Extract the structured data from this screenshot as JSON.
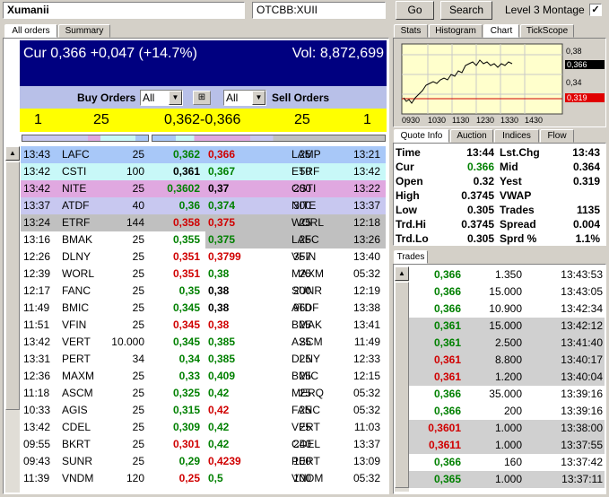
{
  "header": {
    "symbol_name": "Xumanii",
    "symbol_code": "OTCBB:XUII",
    "go": "Go",
    "search": "Search",
    "level3": "Level 3 Montage",
    "check": "✓"
  },
  "left_tabs": [
    "All orders",
    "Summary"
  ],
  "summary": {
    "cur": "Cur 0,366 +0,047 (+14.7%)",
    "vol": "Vol: 8,872,699"
  },
  "orders_bar": {
    "buy": "Buy Orders",
    "sell": "Sell Orders",
    "buy_filter": "All",
    "sell_filter": "All"
  },
  "inside": {
    "bid_count": "1",
    "bid_size": "25",
    "spread": "0,362-0,366",
    "ask_size": "25",
    "ask_count": "1"
  },
  "colors": {
    "navy": "#000080",
    "yellow": "#ffff00",
    "lav": "#c8c8f0",
    "blue": "#a8c8f8",
    "cyan": "#c8f8f8",
    "pink": "#e0a8e0",
    "lgray": "#d0d0d0",
    "mgray": "#c0c0c0"
  },
  "bids": [
    {
      "t": "13:43",
      "mm": "LAFC",
      "sz": "25",
      "px": "0,362",
      "c": "g",
      "bg": "blue"
    },
    {
      "t": "13:42",
      "mm": "CSTI",
      "sz": "100",
      "px": "0,361",
      "c": "k",
      "bg": "cyan"
    },
    {
      "t": "13:42",
      "mm": "NITE",
      "sz": "25",
      "px": "0,3602",
      "c": "g",
      "bg": "pink"
    },
    {
      "t": "13:37",
      "mm": "ATDF",
      "sz": "40",
      "px": "0,36",
      "c": "g",
      "bg": "lav"
    },
    {
      "t": "13:24",
      "mm": "ETRF",
      "sz": "144",
      "px": "0,358",
      "c": "r",
      "bg": "mgray"
    },
    {
      "t": "13:16",
      "mm": "BMAK",
      "sz": "25",
      "px": "0,355",
      "c": "g",
      "bg": ""
    },
    {
      "t": "12:26",
      "mm": "DLNY",
      "sz": "25",
      "px": "0,351",
      "c": "r",
      "bg": ""
    },
    {
      "t": "12:39",
      "mm": "WORL",
      "sz": "25",
      "px": "0,351",
      "c": "r",
      "bg": ""
    },
    {
      "t": "12:17",
      "mm": "FANC",
      "sz": "25",
      "px": "0,35",
      "c": "g",
      "bg": ""
    },
    {
      "t": "11:49",
      "mm": "BMIC",
      "sz": "25",
      "px": "0,345",
      "c": "g",
      "bg": ""
    },
    {
      "t": "11:51",
      "mm": "VFIN",
      "sz": "25",
      "px": "0,345",
      "c": "r",
      "bg": ""
    },
    {
      "t": "13:42",
      "mm": "VERT",
      "sz": "10.000",
      "px": "0,345",
      "c": "g",
      "bg": ""
    },
    {
      "t": "13:31",
      "mm": "PERT",
      "sz": "34",
      "px": "0,34",
      "c": "g",
      "bg": ""
    },
    {
      "t": "12:36",
      "mm": "MAXM",
      "sz": "25",
      "px": "0,33",
      "c": "g",
      "bg": ""
    },
    {
      "t": "11:18",
      "mm": "ASCM",
      "sz": "25",
      "px": "0,325",
      "c": "g",
      "bg": ""
    },
    {
      "t": "10:33",
      "mm": "AGIS",
      "sz": "25",
      "px": "0,315",
      "c": "g",
      "bg": ""
    },
    {
      "t": "13:42",
      "mm": "CDEL",
      "sz": "25",
      "px": "0,309",
      "c": "g",
      "bg": ""
    },
    {
      "t": "09:55",
      "mm": "BKRT",
      "sz": "25",
      "px": "0,301",
      "c": "r",
      "bg": ""
    },
    {
      "t": "09:43",
      "mm": "SUNR",
      "sz": "25",
      "px": "0,29",
      "c": "g",
      "bg": ""
    },
    {
      "t": "11:39",
      "mm": "VNDM",
      "sz": "120",
      "px": "0,25",
      "c": "r",
      "bg": ""
    }
  ],
  "asks": [
    {
      "px": "0,366",
      "c": "r",
      "sz": "25",
      "mm": "LAMP",
      "t": "13:21",
      "bg": "blue"
    },
    {
      "px": "0,367",
      "c": "g",
      "sz": "50",
      "mm": "ETRF",
      "t": "13:42",
      "bg": "cyan"
    },
    {
      "px": "0,37",
      "c": "k",
      "sz": "200",
      "mm": "CSTI",
      "t": "13:22",
      "bg": "pink"
    },
    {
      "px": "0,374",
      "c": "g",
      "sz": "300",
      "mm": "NITE",
      "t": "13:37",
      "bg": "lav"
    },
    {
      "px": "0,375",
      "c": "r",
      "sz": "25",
      "mm": "WORL",
      "t": "12:18",
      "bg": "mgray"
    },
    {
      "px": "0,375",
      "c": "g",
      "sz": "25",
      "mm": "LAFC",
      "t": "13:26",
      "bg": "mgray"
    },
    {
      "px": "0,3799",
      "c": "r",
      "sz": "357",
      "mm": "VFIN",
      "t": "13:40",
      "bg": ""
    },
    {
      "px": "0,38",
      "c": "g",
      "sz": "25",
      "mm": "MAXM",
      "t": "05:32",
      "bg": ""
    },
    {
      "px": "0,38",
      "c": "k",
      "sz": "200",
      "mm": "SUNR",
      "t": "12:19",
      "bg": ""
    },
    {
      "px": "0,38",
      "c": "k",
      "sz": "960",
      "mm": "ATDF",
      "t": "13:38",
      "bg": ""
    },
    {
      "px": "0,38",
      "c": "r",
      "sz": "25",
      "mm": "BMAK",
      "t": "13:41",
      "bg": ""
    },
    {
      "px": "0,385",
      "c": "g",
      "sz": "25",
      "mm": "ASCM",
      "t": "11:49",
      "bg": ""
    },
    {
      "px": "0,385",
      "c": "g",
      "sz": "25",
      "mm": "DLNY",
      "t": "12:33",
      "bg": ""
    },
    {
      "px": "0,409",
      "c": "g",
      "sz": "25",
      "mm": "BMIC",
      "t": "12:15",
      "bg": ""
    },
    {
      "px": "0,42",
      "c": "g",
      "sz": "25",
      "mm": "MERQ",
      "t": "05:32",
      "bg": ""
    },
    {
      "px": "0,42",
      "c": "r",
      "sz": "25",
      "mm": "FANC",
      "t": "05:32",
      "bg": ""
    },
    {
      "px": "0,42",
      "c": "g",
      "sz": "25",
      "mm": "VERT",
      "t": "11:03",
      "bg": ""
    },
    {
      "px": "0,42",
      "c": "g",
      "sz": "240",
      "mm": "CDEL",
      "t": "13:37",
      "bg": ""
    },
    {
      "px": "0,4239",
      "c": "r",
      "sz": "100",
      "mm": "PERT",
      "t": "13:09",
      "bg": ""
    },
    {
      "px": "0,5",
      "c": "g",
      "sz": "100",
      "mm": "VNDM",
      "t": "05:32",
      "bg": ""
    }
  ],
  "right_tabs_top": [
    "Stats",
    "Histogram",
    "Chart",
    "TickScope"
  ],
  "chart": {
    "y_ticks": [
      "0,38",
      "0,366",
      "0,34",
      "0,319"
    ],
    "x_ticks": [
      "0930",
      "1030",
      "1130",
      "1230",
      "1330",
      "1430"
    ]
  },
  "right_tabs_mid": [
    "Quote Info",
    "Auction",
    "Indices",
    "Flow"
  ],
  "quote": [
    [
      "Time",
      "13:44",
      "Lst.Chg",
      "13:43"
    ],
    [
      "Cur",
      "0.366",
      "Mid",
      "0.364"
    ],
    [
      "Open",
      "0.32",
      "Yest",
      "0.319"
    ],
    [
      "High",
      "0.3745",
      "VWAP",
      ""
    ],
    [
      "Low",
      "0.305",
      "Trades",
      "1135"
    ],
    [
      "Trd.Hi",
      "0.3745",
      "Spread",
      "0.004"
    ],
    [
      "Trd.Lo",
      "0.305",
      "Sprd %",
      "1.1%"
    ]
  ],
  "trades_tab": "Trades",
  "trades": [
    {
      "px": "0,366",
      "c": "g",
      "sz": "1.350",
      "t": "13:43:53",
      "bg": ""
    },
    {
      "px": "0,366",
      "c": "g",
      "sz": "15.000",
      "t": "13:43:05",
      "bg": ""
    },
    {
      "px": "0,366",
      "c": "g",
      "sz": "10.900",
      "t": "13:42:34",
      "bg": ""
    },
    {
      "px": "0,361",
      "c": "g",
      "sz": "15.000",
      "t": "13:42:12",
      "bg": "lgray"
    },
    {
      "px": "0,361",
      "c": "g",
      "sz": "2.500",
      "t": "13:41:40",
      "bg": "lgray"
    },
    {
      "px": "0,361",
      "c": "r",
      "sz": "8.800",
      "t": "13:40:17",
      "bg": "lgray"
    },
    {
      "px": "0,361",
      "c": "r",
      "sz": "1.200",
      "t": "13:40:04",
      "bg": "lgray"
    },
    {
      "px": "0,366",
      "c": "g",
      "sz": "35.000",
      "t": "13:39:16",
      "bg": ""
    },
    {
      "px": "0,366",
      "c": "g",
      "sz": "200",
      "t": "13:39:16",
      "bg": ""
    },
    {
      "px": "0,3601",
      "c": "r",
      "sz": "1.000",
      "t": "13:38:00",
      "bg": "lgray"
    },
    {
      "px": "0,3611",
      "c": "r",
      "sz": "1.000",
      "t": "13:37:55",
      "bg": "lgray"
    },
    {
      "px": "0,366",
      "c": "g",
      "sz": "160",
      "t": "13:37:42",
      "bg": ""
    },
    {
      "px": "0,365",
      "c": "g",
      "sz": "1.000",
      "t": "13:37:11",
      "bg": "lgray"
    }
  ]
}
